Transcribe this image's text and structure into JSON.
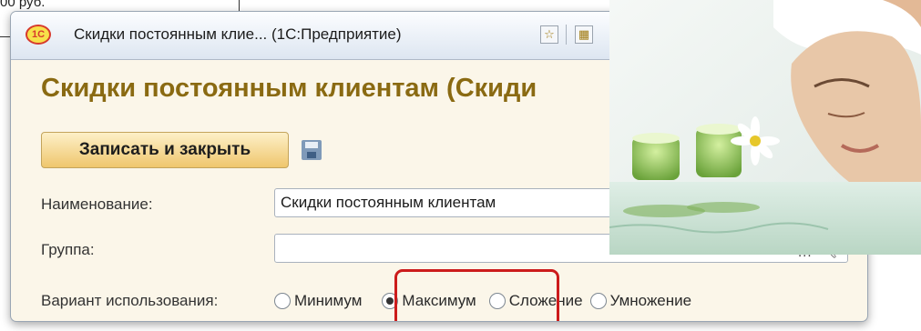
{
  "background": {
    "fragment_text": "00 руб."
  },
  "window": {
    "title": "Скидки постоянным клие... (1С:Предприятие)",
    "app_icon_text": "1С"
  },
  "form": {
    "title": "Скидки постоянным клиентам (Скиди",
    "save_close_label": "Записать и закрыть",
    "name_label": "Наименование:",
    "name_value": "Скидки постоянным клиентам",
    "group_label": "Группа:",
    "group_value": "",
    "choose_glyph": "...",
    "usage_label": "Вариант использования:",
    "usage_options": [
      "Минимум",
      "Максимум",
      "Сложение",
      "Умножение"
    ],
    "usage_selected": "Максимум"
  },
  "colors": {
    "form_title": "#8a6a12",
    "highlight": "#cc1b1b",
    "window_bg": "#fbf6e9",
    "save_button": "#efc66d"
  },
  "icons": [
    "1c-app-icon",
    "favorite-star-icon",
    "calculator-icon",
    "floppy-disk-icon",
    "search-icon"
  ]
}
